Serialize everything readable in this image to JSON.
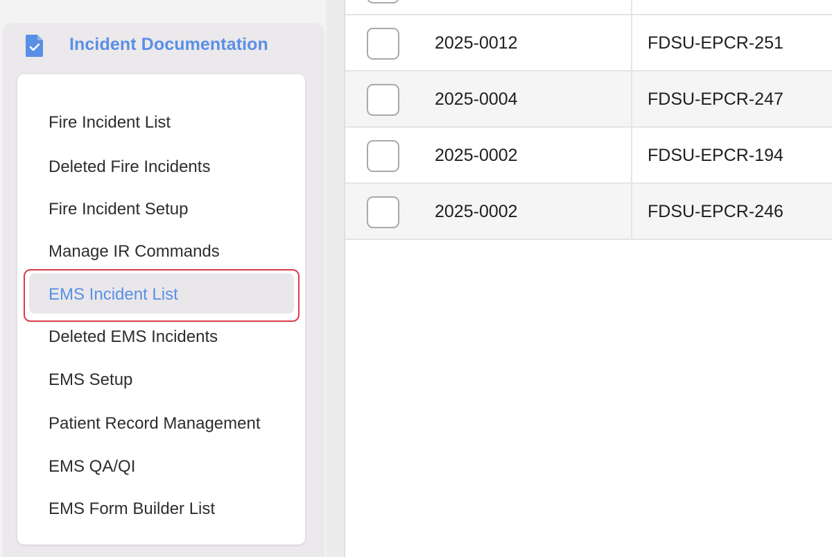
{
  "sidebar": {
    "section_title": "Incident Documentation",
    "section_icon": "document-check-icon",
    "accent_color": "#5a8fe6",
    "items": [
      {
        "label": "Fire Incident List",
        "active": false
      },
      {
        "label": "Deleted Fire Incidents",
        "active": false
      },
      {
        "label": "Fire Incident Setup",
        "active": false
      },
      {
        "label": "Manage IR Commands",
        "active": false
      },
      {
        "label": "EMS Incident List",
        "active": true
      },
      {
        "label": "Deleted EMS Incidents",
        "active": false
      },
      {
        "label": "EMS Setup",
        "active": false
      },
      {
        "label": "Patient Record Management",
        "active": false
      },
      {
        "label": "EMS QA/QI",
        "active": false
      },
      {
        "label": "EMS Form Builder List",
        "active": false
      }
    ]
  },
  "table": {
    "rows": [
      {
        "incident_number": "2025-0012",
        "record_id": "FDSU-EPCR-251",
        "checked": false
      },
      {
        "incident_number": "2025-0004",
        "record_id": "FDSU-EPCR-247",
        "checked": false
      },
      {
        "incident_number": "2025-0002",
        "record_id": "FDSU-EPCR-194",
        "checked": false
      },
      {
        "incident_number": "2025-0002",
        "record_id": "FDSU-EPCR-246",
        "checked": false
      }
    ]
  },
  "highlight_color": "#d93a4a"
}
